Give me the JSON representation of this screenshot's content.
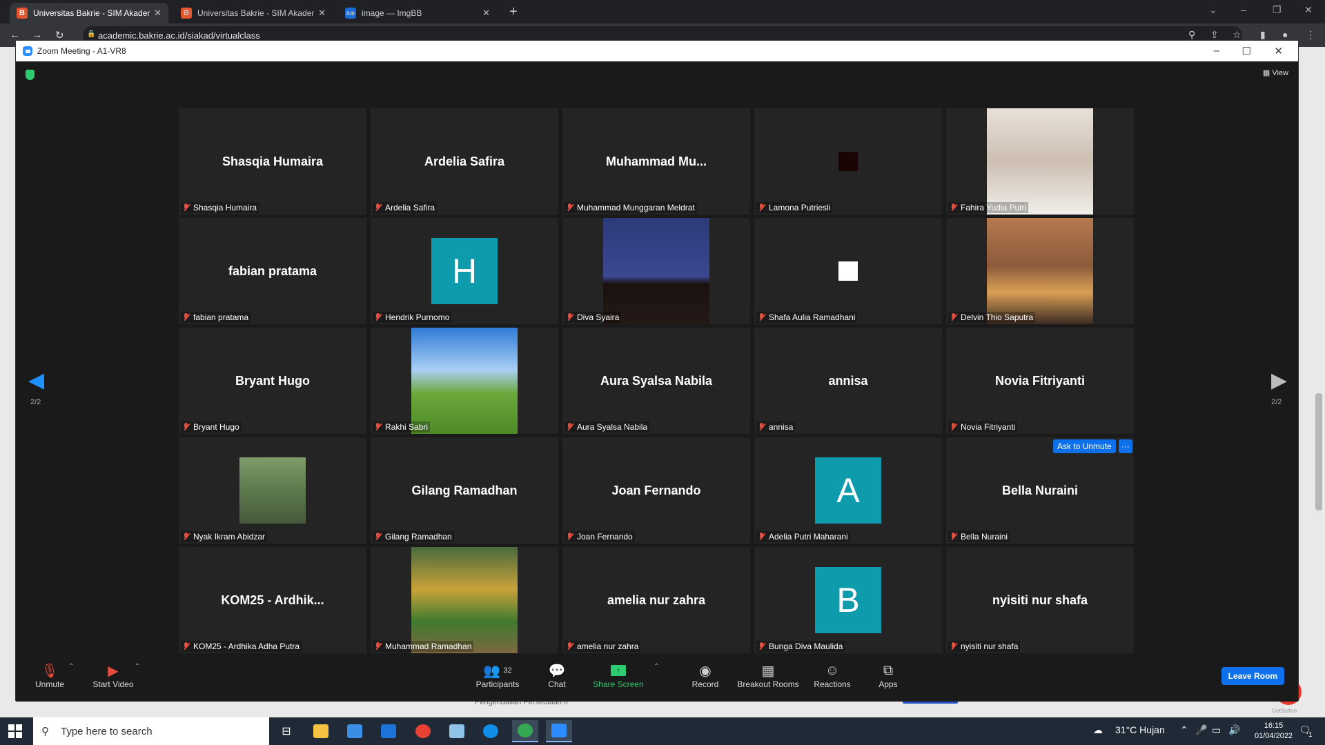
{
  "browser": {
    "tabs": [
      {
        "title": "Universitas Bakrie - SIM Akademi",
        "icon": "bakrie-favicon",
        "active": true
      },
      {
        "title": "Universitas Bakrie - SIM Akadem",
        "icon": "bakrie-favicon",
        "active": false
      },
      {
        "title": "image — ImgBB",
        "icon": "imgbb-favicon",
        "active": false
      }
    ],
    "url": "academic.bakrie.ac.id/siakad/virtualclass"
  },
  "behind_page": {
    "text": "Pengendalian Persediaan II",
    "getbutton_label": "GetButton"
  },
  "zoom": {
    "window_title": "Zoom Meeting - A1-VR8",
    "view_label": "View",
    "page_indicator_left": "2/2",
    "page_indicator_right": "2/2",
    "ask_to_unmute": "Ask to Unmute",
    "more_label": "···",
    "tiles": [
      {
        "display": "Shasqia Humaira",
        "caption": "Shasqia Humaira",
        "kind": "name"
      },
      {
        "display": "Ardelia Safira",
        "caption": "Ardelia Safira",
        "kind": "name"
      },
      {
        "display": "Muhammad  Mu...",
        "caption": "Muhammad Munggaran Meldrat",
        "kind": "name"
      },
      {
        "display": "",
        "caption": "Lamona Putriesli",
        "kind": "dark-square"
      },
      {
        "display": "",
        "caption": "Fahira Yudia Putri",
        "kind": "photo-portrait"
      },
      {
        "display": "fabian pratama",
        "caption": "fabian pratama",
        "kind": "name"
      },
      {
        "display": "H",
        "caption": "Hendrik Purnomo",
        "kind": "letter"
      },
      {
        "display": "",
        "caption": "Diva Syaira",
        "kind": "photo-night"
      },
      {
        "display": "",
        "caption": "Shafa Aulia Ramadhani",
        "kind": "white-square"
      },
      {
        "display": "",
        "caption": "Delvin Thio Saputra",
        "kind": "photo-wall"
      },
      {
        "display": "Bryant Hugo",
        "caption": "Bryant Hugo",
        "kind": "name"
      },
      {
        "display": "",
        "caption": "Rakhi Sabri",
        "kind": "photo-bliss"
      },
      {
        "display": "Aura Syalsa Nabila",
        "caption": "Aura Syalsa Nabila",
        "kind": "name"
      },
      {
        "display": "annisa",
        "caption": "annisa",
        "kind": "name"
      },
      {
        "display": "Novia Fitriyanti",
        "caption": "Novia Fitriyanti",
        "kind": "name"
      },
      {
        "display": "",
        "caption": "Nyak Ikram Abidzar",
        "kind": "photo-outdoor"
      },
      {
        "display": "Gilang Ramadhan",
        "caption": "Gilang Ramadhan",
        "kind": "name"
      },
      {
        "display": "Joan Fernando",
        "caption": "Joan Fernando",
        "kind": "name"
      },
      {
        "display": "A",
        "caption": "Adelia Putri Maharani",
        "kind": "letter"
      },
      {
        "display": "Bella Nuraini",
        "caption": "Bella Nuraini",
        "kind": "name"
      },
      {
        "display": "KOM25  - Ardhik...",
        "caption": "KOM25 - Ardhika Adha Putra",
        "kind": "name"
      },
      {
        "display": "",
        "caption": "Muhammad Ramadhan",
        "kind": "photo-field"
      },
      {
        "display": "amelia nur zahra",
        "caption": "amelia nur zahra",
        "kind": "name"
      },
      {
        "display": "B",
        "caption": "Bunga Diva Maulida",
        "kind": "letter"
      },
      {
        "display": "nyisiti nur shafa",
        "caption": "nyisiti nur shafa",
        "kind": "name"
      }
    ],
    "toolbar": {
      "unmute": "Unmute",
      "start_video": "Start Video",
      "participants": "Participants",
      "participant_count": "32",
      "chat": "Chat",
      "share_screen": "Share Screen",
      "record": "Record",
      "breakout_rooms": "Breakout Rooms",
      "reactions": "Reactions",
      "apps": "Apps",
      "leave_room": "Leave Room"
    }
  },
  "taskbar": {
    "search_placeholder": "Type here to search",
    "weather": "31°C  Hujan",
    "time": "16:15",
    "date": "01/04/2022",
    "notification_count": "1"
  },
  "colors": {
    "accent": "#0e71eb",
    "avatar_teal": "#0e9cac",
    "share_green": "#2ecc71",
    "muted_red": "#e74c3c"
  }
}
